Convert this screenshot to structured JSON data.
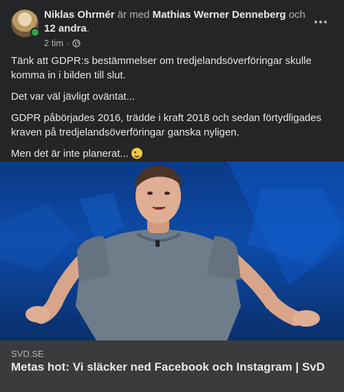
{
  "post": {
    "author": "Niklas Ohrmér",
    "with_text": "är med",
    "tagged_person": "Mathias Werner Denneberg",
    "and_text": "och",
    "others": "12 andra",
    "time": "2 tim",
    "separator": "·",
    "privacy_icon": "globe-icon",
    "paragraphs": [
      "Tänk att GDPR:s bestämmelser om tredjelandsöverföringar skulle komma in i bilden till slut.",
      "Det var väl jävligt oväntat...",
      "GDPR påbörjades 2016, trädde i kraft 2018 och sedan förtydligades kraven på tredjelandsöverföringar ganska nyligen.",
      "Men det är inte planerat..."
    ],
    "emoji": "smirk-emoji"
  },
  "link": {
    "domain": "SVD.SE",
    "title": "Metas hot: Vi släcker ned Facebook och Instagram | SvD"
  },
  "colors": {
    "background": "#242526",
    "text": "#e4e6eb",
    "secondary_text": "#b0b3b8",
    "online": "#31a24c",
    "link_footer": "#3a3b3c"
  }
}
